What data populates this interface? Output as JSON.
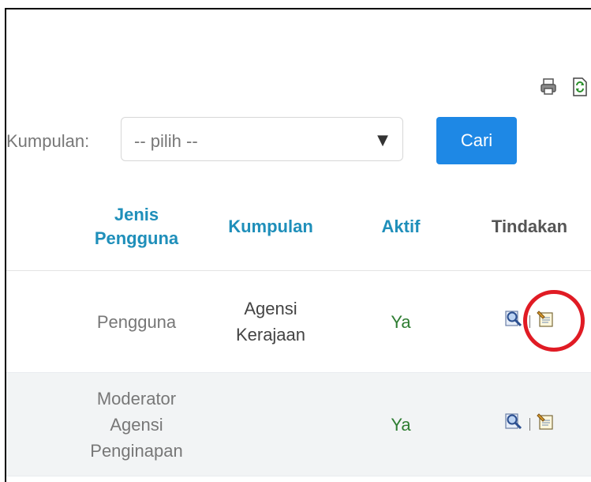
{
  "filter": {
    "label": "Kumpulan:",
    "select_value": "-- pilih --",
    "search_button": "Cari"
  },
  "table": {
    "headers": {
      "jenis_line1": "Jenis",
      "jenis_line2": "Pengguna",
      "kumpulan": "Kumpulan",
      "aktif": "Aktif",
      "tindakan": "Tindakan"
    },
    "rows": [
      {
        "jenis": "Pengguna",
        "kumpulan_line1": "Agensi",
        "kumpulan_line2": "Kerajaan",
        "aktif": "Ya"
      },
      {
        "jenis_line1": "Moderator",
        "jenis_line2": "Agensi",
        "jenis_line3": "Penginapan",
        "aktif": "Ya"
      }
    ]
  },
  "icons": {
    "print": "printer-icon",
    "refresh": "refresh-icon",
    "view": "magnifier-icon",
    "edit": "edit-icon"
  },
  "colors": {
    "accent": "#1e88e5",
    "header_link": "#1f8fba",
    "active_status": "#2e7d32",
    "highlight_circle": "#e01b24"
  }
}
